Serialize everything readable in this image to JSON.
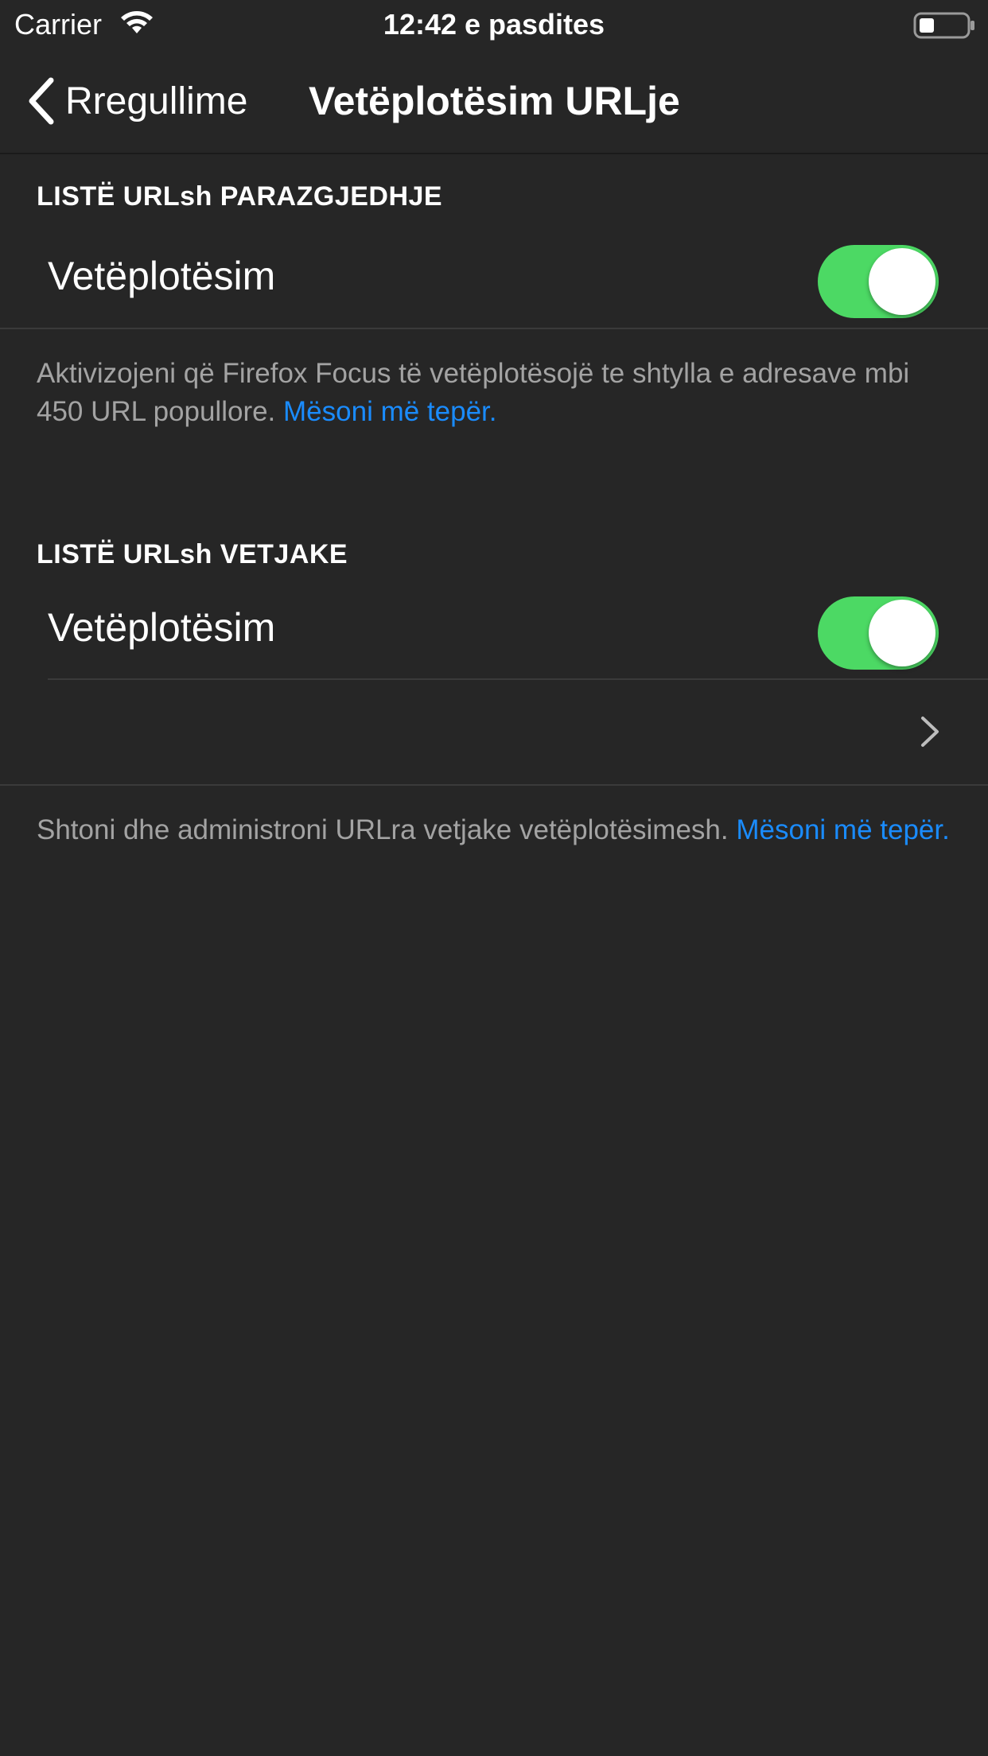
{
  "status_bar": {
    "carrier": "Carrier",
    "time": "12:42 e pasdites"
  },
  "nav": {
    "back_label": "Rregullime",
    "title": "Vetëplotësim URLje"
  },
  "section_default": {
    "header": "LISTË URLsh PARAZGJEDHJE",
    "toggle_label": "Vetëplotësim",
    "toggle_on": true,
    "footer_text": "Aktivizojeni që Firefox Focus të vetëplotësojë te shtylla e adresave mbi 450 URL popullore.",
    "footer_link": "Mësoni më tepër."
  },
  "section_custom": {
    "header": "LISTË URLsh VETJAKE",
    "toggle_label": "Vetëplotësim",
    "toggle_on": true,
    "footer_text": "Shtoni dhe administroni URLra vetjake vetëplotësimesh.",
    "footer_link": "Mësoni më tepër."
  },
  "colors": {
    "background": "#262626",
    "toggle_on": "#4cd964",
    "link": "#1a8cff",
    "secondary_text": "#a3a3a3"
  }
}
